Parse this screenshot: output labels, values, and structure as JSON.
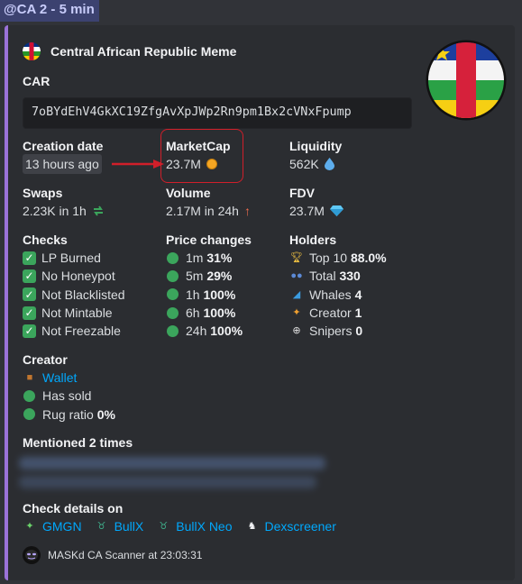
{
  "channel_tag": "@CA 2 - 5 min",
  "author": {
    "name": "Central African Republic Meme",
    "icon": "car-flag-icon"
  },
  "symbol": "CAR",
  "contract_address": "7oBYdEhV4GkXC19ZfgAvXpJWp2Rn9pm1Bx2cVNxFpump",
  "fields": {
    "creation_date": {
      "label": "Creation date",
      "value": "13 hours ago"
    },
    "market_cap": {
      "label": "MarketCap",
      "value": "23.7M"
    },
    "liquidity": {
      "label": "Liquidity",
      "value": "562K"
    },
    "swaps": {
      "label": "Swaps",
      "value": "2.23K in 1h"
    },
    "volume": {
      "label": "Volume",
      "value": "2.17M in 24h"
    },
    "fdv": {
      "label": "FDV",
      "value": "23.7M"
    }
  },
  "checks": {
    "label": "Checks",
    "items": [
      "LP Burned",
      "No Honeypot",
      "Not Blacklisted",
      "Not Mintable",
      "Not Freezable"
    ]
  },
  "price_changes": {
    "label": "Price changes",
    "items": [
      {
        "period": "1m",
        "value": "31%"
      },
      {
        "period": "5m",
        "value": "29%"
      },
      {
        "period": "1h",
        "value": "100%"
      },
      {
        "period": "6h",
        "value": "100%"
      },
      {
        "period": "24h",
        "value": "100%"
      }
    ]
  },
  "holders": {
    "label": "Holders",
    "items": [
      {
        "name": "Top 10",
        "value": "88.0%",
        "icon": "trophy-icon"
      },
      {
        "name": "Total",
        "value": "330",
        "icon": "people-icon"
      },
      {
        "name": "Whales",
        "value": "4",
        "icon": "whale-icon"
      },
      {
        "name": "Creator",
        "value": "1",
        "icon": "creator-icon"
      },
      {
        "name": "Snipers",
        "value": "0",
        "icon": "sniper-icon"
      }
    ]
  },
  "creator": {
    "label": "Creator",
    "wallet_label": "Wallet",
    "has_sold": "Has sold",
    "rug_ratio_label": "Rug ratio",
    "rug_ratio_value": "0%"
  },
  "mentioned": {
    "label": "Mentioned 2 times"
  },
  "check_details": {
    "label": "Check details on",
    "links": [
      "GMGN",
      "BullX",
      "BullX Neo",
      "Dexscreener"
    ]
  },
  "footer": {
    "text": "MASKd CA Scanner at 23:03:31"
  },
  "colors": {
    "embed_border": "#9b72d9",
    "link": "#00a8fc",
    "status_green": "#3ba55c",
    "highlight_red": "#d11f2a"
  }
}
